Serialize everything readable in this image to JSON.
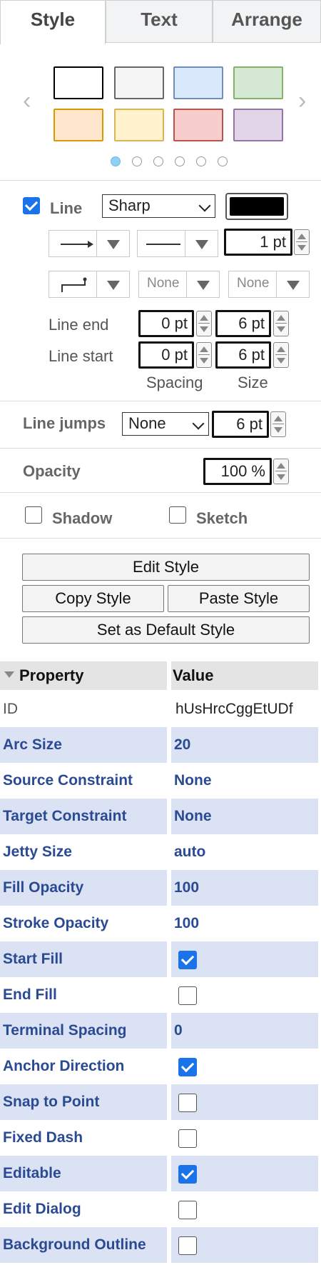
{
  "tabs": [
    "Style",
    "Text",
    "Arrange"
  ],
  "swatches": [
    {
      "fill": "#ffffff",
      "stroke": "#000000"
    },
    {
      "fill": "#f5f5f5",
      "stroke": "#666666"
    },
    {
      "fill": "#dae8fc",
      "stroke": "#6c8ebf"
    },
    {
      "fill": "#d5e8d4",
      "stroke": "#82b366"
    },
    {
      "fill": "#ffe6cc",
      "stroke": "#d79b00"
    },
    {
      "fill": "#fff2cc",
      "stroke": "#d6b656"
    },
    {
      "fill": "#f8cecc",
      "stroke": "#b85450"
    },
    {
      "fill": "#e1d5e7",
      "stroke": "#9673a6"
    }
  ],
  "page_dots": {
    "count": 6,
    "active": 0
  },
  "line": {
    "label": "Line",
    "checked": true,
    "style": "Sharp",
    "color": "#000000",
    "width": "1 pt",
    "start_marker": "None",
    "end_marker": "None",
    "line_end_label": "Line end",
    "line_start_label": "Line start",
    "line_end_spacing": "0 pt",
    "line_end_size": "6 pt",
    "line_start_spacing": "0 pt",
    "line_start_size": "6 pt",
    "spacing_label": "Spacing",
    "size_label": "Size"
  },
  "line_jumps": {
    "label": "Line jumps",
    "value": "None",
    "size": "6 pt"
  },
  "opacity": {
    "label": "Opacity",
    "value": "100 %"
  },
  "shadow": {
    "label": "Shadow",
    "checked": false
  },
  "sketch": {
    "label": "Sketch",
    "checked": false
  },
  "buttons": {
    "edit_style": "Edit Style",
    "copy_style": "Copy Style",
    "paste_style": "Paste Style",
    "set_default": "Set as Default Style"
  },
  "properties": {
    "header_property": "Property",
    "header_value": "Value",
    "rows": [
      {
        "key": "ID",
        "value": "hUsHrcCggEtUDf",
        "plain": true
      },
      {
        "key": "Arc Size",
        "value": "20"
      },
      {
        "key": "Source Constraint",
        "value": "None"
      },
      {
        "key": "Target Constraint",
        "value": "None"
      },
      {
        "key": "Jetty Size",
        "value": "auto"
      },
      {
        "key": "Fill Opacity",
        "value": "100"
      },
      {
        "key": "Stroke Opacity",
        "value": "100"
      },
      {
        "key": "Start Fill",
        "checkbox": true,
        "checked": true
      },
      {
        "key": "End Fill",
        "checkbox": true,
        "checked": false
      },
      {
        "key": "Terminal Spacing",
        "value": "0"
      },
      {
        "key": "Anchor Direction",
        "checkbox": true,
        "checked": true
      },
      {
        "key": "Snap to Point",
        "checkbox": true,
        "checked": false
      },
      {
        "key": "Fixed Dash",
        "checkbox": true,
        "checked": false
      },
      {
        "key": "Editable",
        "checkbox": true,
        "checked": true
      },
      {
        "key": "Edit Dialog",
        "checkbox": true,
        "checked": false
      },
      {
        "key": "Background Outline",
        "checkbox": true,
        "checked": false
      }
    ]
  }
}
